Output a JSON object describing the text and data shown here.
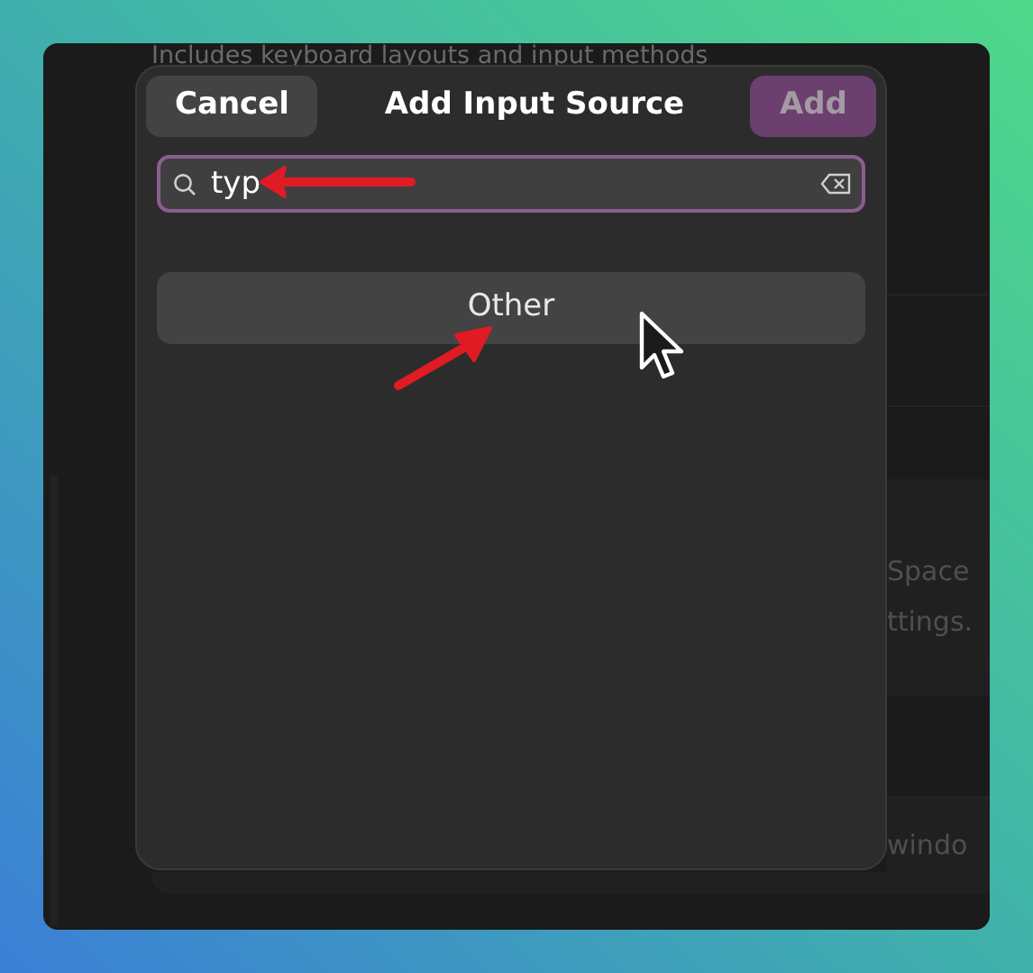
{
  "background_window": {
    "description": "Includes keyboard layouts and input methods",
    "side_texts": [
      "Space",
      "ttings.",
      "windo"
    ]
  },
  "dialog": {
    "title": "Add Input Source",
    "cancel_button": "Cancel",
    "add_button": {
      "label": "Add",
      "disabled": true
    },
    "search": {
      "value": "typ"
    },
    "results": [
      {
        "label": "Other",
        "hovered": true
      }
    ]
  }
}
